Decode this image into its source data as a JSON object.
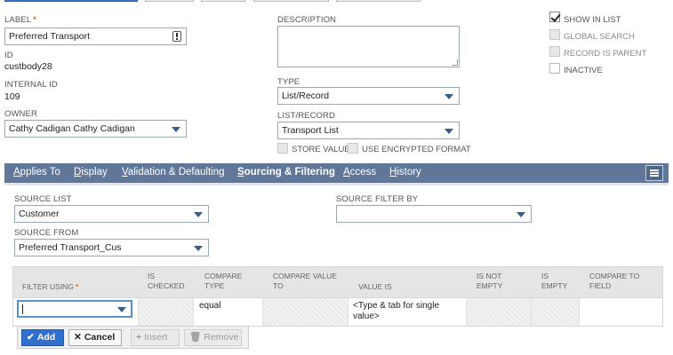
{
  "colors": {
    "tab_bar": "#607799",
    "primary": "#2f6fce",
    "required": "#e07a00"
  },
  "fields": {
    "label_label": "LABEL",
    "label_required": "*",
    "label_value": "Preferred Transport",
    "id_label": "ID",
    "id_value": "custbody28",
    "internal_id_label": "INTERNAL ID",
    "internal_id_value": "109",
    "owner_label": "OWNER",
    "owner_value": "Cathy Cadigan Cathy Cadigan",
    "description_label": "DESCRIPTION",
    "description_value": "",
    "type_label": "TYPE",
    "type_value": "List/Record",
    "list_record_label": "LIST/RECORD",
    "list_record_value": "Transport List",
    "store_value_label": "STORE VALUE",
    "encrypted_label": "USE ENCRYPTED FORMAT"
  },
  "options": {
    "show_in_list": {
      "label": "SHOW IN LIST",
      "checked": true
    },
    "global_search": {
      "label": "GLOBAL SEARCH",
      "checked": false
    },
    "record_is_parent": {
      "label": "RECORD IS PARENT",
      "checked": false
    },
    "inactive": {
      "label": "INACTIVE",
      "checked": false
    }
  },
  "tabs": [
    {
      "pre": "",
      "u": "A",
      "post": "pplies To"
    },
    {
      "pre": "",
      "u": "D",
      "post": "isplay"
    },
    {
      "pre": "",
      "u": "V",
      "post": "alidation & Defaulting"
    },
    {
      "pre": "",
      "u": "S",
      "post": "ourcing & Filtering"
    },
    {
      "pre": "",
      "u": "A",
      "post": "ccess"
    },
    {
      "pre": "",
      "u": "H",
      "post": "istory"
    }
  ],
  "sourcing": {
    "source_list_label": "SOURCE LIST",
    "source_list_value": "Customer",
    "source_from_label": "SOURCE FROM",
    "source_from_value": "Preferred Transport_Cus",
    "source_filter_by_label": "SOURCE FILTER BY",
    "source_filter_by_value": ""
  },
  "grid": {
    "headers": {
      "filter_using": "FILTER USING",
      "filter_using_req": "*",
      "is_checked": "IS CHECKED",
      "compare_type": "COMPARE TYPE",
      "compare_value_to": "COMPARE VALUE TO",
      "value_is": "VALUE IS",
      "is_not_empty": "IS NOT EMPTY",
      "is_empty": "IS EMPTY",
      "compare_to_field": "COMPARE TO FIELD"
    },
    "row": {
      "compare_type": "equal",
      "value_is": "<Type & tab for single value>"
    }
  },
  "buttons": {
    "add": "Add",
    "cancel": "Cancel",
    "insert": "Insert",
    "remove": "Remove"
  }
}
